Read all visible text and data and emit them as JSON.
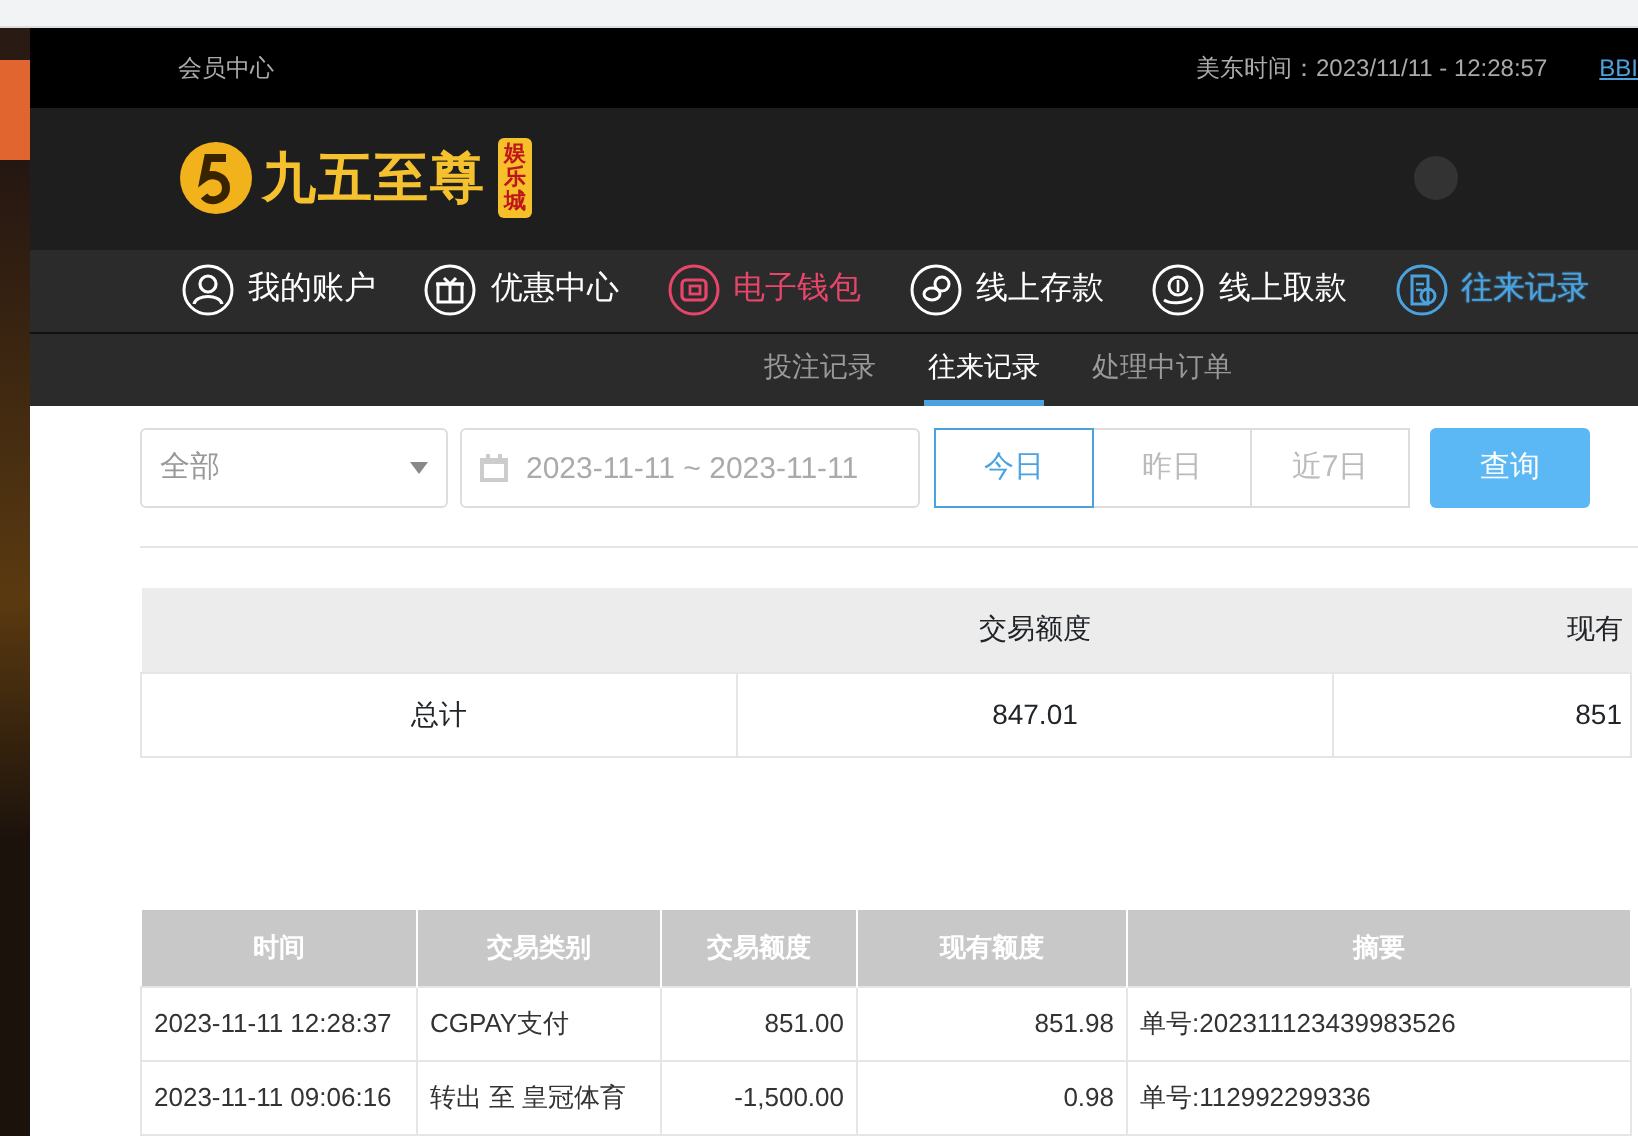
{
  "top_bar": {
    "member_center": "会员中心",
    "time_label": "美东时间：2023/11/11 - 12:28:57",
    "link": "BBI"
  },
  "logo": {
    "name": "九五至尊",
    "badge": "娱乐城"
  },
  "nav": [
    {
      "label": "我的账户",
      "color": "#ffffff",
      "selected": false
    },
    {
      "label": "优惠中心",
      "color": "#ffffff",
      "selected": false
    },
    {
      "label": "电子钱包",
      "color": "#e8456b",
      "selected": false
    },
    {
      "label": "线上存款",
      "color": "#ffffff",
      "selected": false
    },
    {
      "label": "线上取款",
      "color": "#ffffff",
      "selected": false
    },
    {
      "label": "往来记录",
      "color": "#4aa3df",
      "selected": true
    }
  ],
  "sub_tabs": [
    {
      "label": "投注记录",
      "selected": false
    },
    {
      "label": "往来记录",
      "selected": true
    },
    {
      "label": "处理中订单",
      "selected": false
    }
  ],
  "filter": {
    "type_select": "全部",
    "date_range": "2023-11-11 ~ 2023-11-11",
    "quick_ranges": [
      {
        "label": "今日",
        "selected": true
      },
      {
        "label": "昨日",
        "selected": false
      },
      {
        "label": "近7日",
        "selected": false
      }
    ],
    "query_button": "查询"
  },
  "summary": {
    "columns": [
      "",
      "交易额度",
      "现有"
    ],
    "row": [
      "总计",
      "847.01",
      "851"
    ]
  },
  "table": {
    "columns": [
      "时间",
      "交易类别",
      "交易额度",
      "现有额度",
      "摘要"
    ],
    "rows": [
      [
        "2023-11-11 12:28:37",
        "CGPAY支付",
        "851.00",
        "851.98",
        "单号:202311123439983526"
      ],
      [
        "2023-11-11 09:06:16",
        "转出 至 皇冠体育",
        "-1,500.00",
        "0.98",
        "单号:112992299336"
      ]
    ]
  }
}
